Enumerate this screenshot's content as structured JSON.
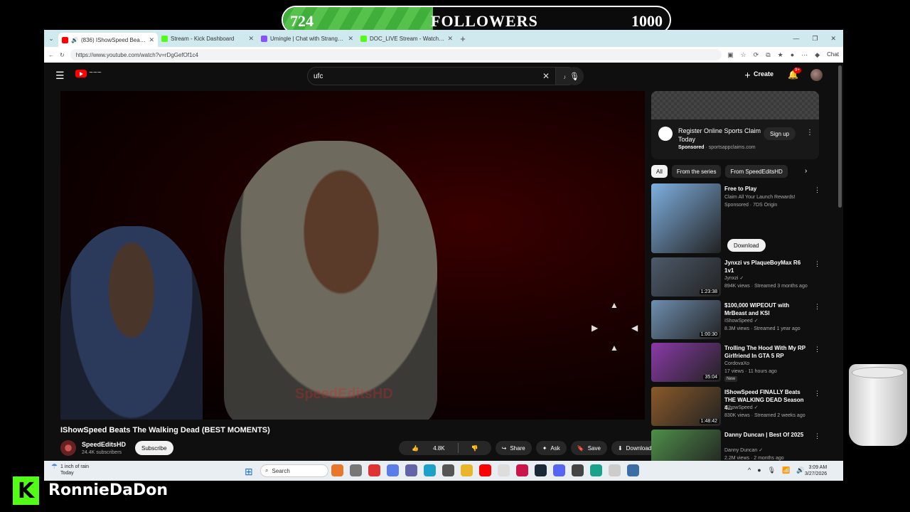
{
  "overlay": {
    "followers_current": "724",
    "followers_label": "FOLLOWERS",
    "followers_goal": "1000",
    "followers_progress": 0.724,
    "streamer_name": "RonnieDaDon",
    "kick_glyph": "K"
  },
  "browser": {
    "tabs": [
      {
        "title": "(836) IShowSpeed Beats The W...",
        "color": "#ff0000",
        "active": true
      },
      {
        "title": "Stream - Kick Dashboard",
        "color": "#53fc18",
        "active": false
      },
      {
        "title": "Umingle | Chat with Strangers Inst...",
        "color": "#8a4fff",
        "active": false
      },
      {
        "title": "DOC_LIVE Stream - Watch Live on...",
        "color": "#53fc18",
        "active": false
      }
    ],
    "url": "https://www.youtube.com/watch?v=rDgGefOf1c4",
    "chat_label": "Chat"
  },
  "youtube": {
    "search_value": "ufc",
    "create_label": "Create",
    "notif_badge": "9+",
    "video": {
      "title": "IShowSpeed Beats The Walking Dead (BEST MOMENTS)",
      "watermark": "SpeedEditsHD",
      "channel": "SpeedEditsHD",
      "subscribers": "24.4K subscribers",
      "subscribe_label": "Subscribe",
      "likes": "4.8K",
      "share_label": "Share",
      "ask_label": "Ask",
      "save_label": "Save",
      "download_label": "Download"
    },
    "ad": {
      "title": "Register Online Sports Claim Today",
      "sponsored": "Sponsored",
      "domain": "sportsappclaims.com",
      "cta": "Sign up"
    },
    "chips": [
      "All",
      "From the series",
      "From SpeedEditsHD"
    ],
    "recommendations": [
      {
        "title": "Free to Play",
        "meta1": "Claim All Your Launch Rewards!",
        "meta2": "Sponsored · 7DS Origin",
        "duration": "",
        "thumb": "#7fb0e0",
        "cta": "Download",
        "is_new": false
      },
      {
        "title": "Jynxzi vs PlaqueBoyMax R6 1v1",
        "meta1": "Jynxzi ✓",
        "meta2": "894K views · Streamed 3 months ago",
        "duration": "1:23:38",
        "thumb": "#4d5a6a",
        "cta": "",
        "is_new": false
      },
      {
        "title": "$100,000 WIPEOUT with MrBeast and KSI",
        "meta1": "IShowSpeed ✓",
        "meta2": "8.3M views · Streamed 1 year ago",
        "duration": "1:00:30",
        "thumb": "#6f8fb0",
        "cta": "",
        "is_new": false
      },
      {
        "title": "Trolling The Hood With My RP Girlfriend In GTA 5 RP",
        "meta1": "CordovaXo",
        "meta2": "17 views · 11 hours ago",
        "duration": "35:04",
        "thumb": "#8b3aa8",
        "cta": "",
        "is_new": true,
        "new_label": "New"
      },
      {
        "title": "IShowSpeed FINALLY Beats THE WALKING DEAD Season 4...",
        "meta1": "IShowSpeed ✓",
        "meta2": "830K views · Streamed 2 weeks ago",
        "duration": "1:48:42",
        "thumb": "#8a5a2a",
        "cta": "",
        "is_new": false
      },
      {
        "title": "Danny Duncan | Best Of 2025",
        "meta1": "Danny Duncan ✓",
        "meta2": "2.2M views · 2 months ago",
        "duration": "",
        "thumb": "#4f8f4a",
        "cta": "",
        "is_new": false
      }
    ]
  },
  "taskbar": {
    "weather_line1": "1 inch of rain",
    "weather_line2": "Today",
    "search_label": "Search",
    "time": "3:09 AM",
    "date": "3/27/2026"
  }
}
